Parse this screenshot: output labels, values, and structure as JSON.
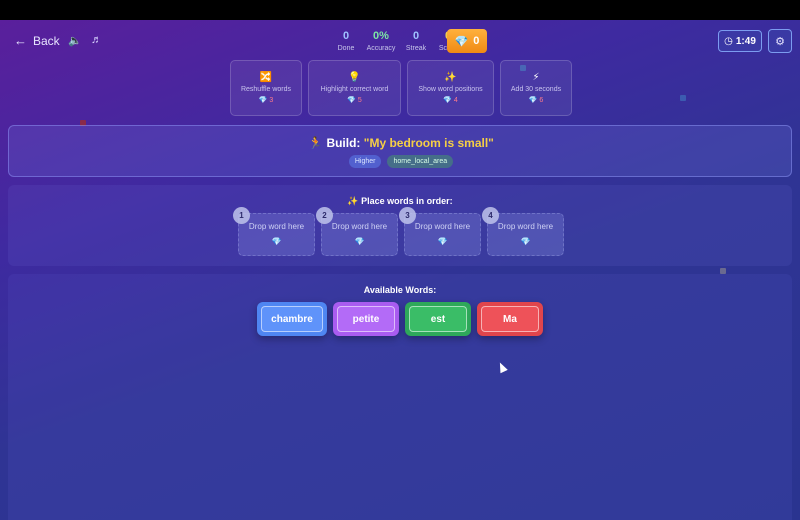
{
  "topbar": {
    "back_label": "Back",
    "stats": [
      {
        "value": "0",
        "label": "Done"
      },
      {
        "value": "0%",
        "label": "Accuracy"
      },
      {
        "value": "0",
        "label": "Streak"
      },
      {
        "value": "0",
        "label": "Score"
      }
    ],
    "gems": "0",
    "timer": "1:49"
  },
  "powerups": [
    {
      "label": "Reshuffle words",
      "cost": "3",
      "icon": "shuffle-icon"
    },
    {
      "label": "Highlight correct word",
      "cost": "5",
      "icon": "lightbulb-icon"
    },
    {
      "label": "Show word positions",
      "cost": "4",
      "icon": "sparkles-icon"
    },
    {
      "label": "Add 30 seconds",
      "cost": "6",
      "icon": "lightning-icon"
    }
  ],
  "build": {
    "prefix": "Build: ",
    "sentence": "\"My bedroom is small\"",
    "level": "Higher",
    "topic": "home_local_area"
  },
  "order": {
    "title": "Place words in order:",
    "slots": [
      {
        "num": "1",
        "text": "Drop word here"
      },
      {
        "num": "2",
        "text": "Drop word here"
      },
      {
        "num": "3",
        "text": "Drop word here"
      },
      {
        "num": "4",
        "text": "Drop word here"
      }
    ]
  },
  "words": {
    "title": "Available Words:",
    "chips": [
      "chambre",
      "petite",
      "est",
      "Ma"
    ]
  },
  "colors": {
    "gem_button": "#f59a1f",
    "accent_yellow": "#f5cf45",
    "chip_blue": "#5f93fa",
    "chip_purple": "#b36bf7",
    "chip_green": "#3abd67",
    "chip_red": "#ee5259"
  }
}
